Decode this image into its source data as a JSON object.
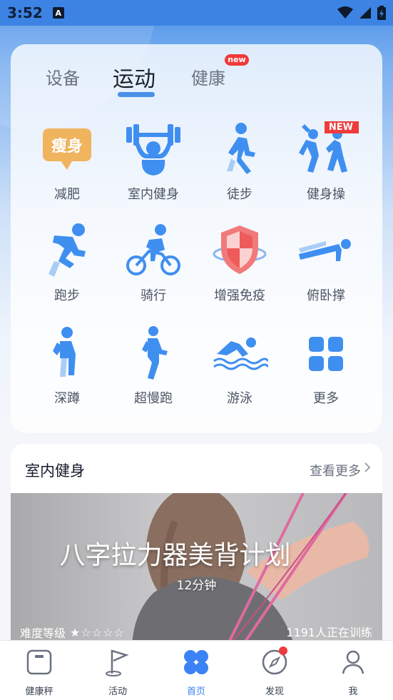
{
  "status": {
    "time": "3:52",
    "a_icon": "A"
  },
  "tabs": [
    {
      "label": "设备",
      "active": false
    },
    {
      "label": "运动",
      "active": true
    },
    {
      "label": "健康",
      "active": false,
      "badge": "new"
    }
  ],
  "grid": [
    {
      "label": "减肥",
      "icon": "weight-loss-icon",
      "icon_text": "瘦身"
    },
    {
      "label": "室内健身",
      "icon": "dumbbell-icon"
    },
    {
      "label": "徒步",
      "icon": "walking-icon"
    },
    {
      "label": "健身操",
      "icon": "aerobics-icon",
      "badge": "NEW"
    },
    {
      "label": "跑步",
      "icon": "running-icon"
    },
    {
      "label": "骑行",
      "icon": "cycling-icon"
    },
    {
      "label": "增强免疫",
      "icon": "shield-icon"
    },
    {
      "label": "俯卧撑",
      "icon": "pushup-icon"
    },
    {
      "label": "深蹲",
      "icon": "squat-icon"
    },
    {
      "label": "超慢跑",
      "icon": "slow-jog-icon"
    },
    {
      "label": "游泳",
      "icon": "swimming-icon"
    },
    {
      "label": "更多",
      "icon": "more-grid-icon"
    }
  ],
  "section": {
    "title": "室内健身",
    "more": "查看更多",
    "banner": {
      "title": "八字拉力器美背计划",
      "duration": "12分钟",
      "difficulty_label": "难度等级",
      "difficulty_stars": 1,
      "difficulty_max": 5,
      "stars_text": "★☆☆☆☆",
      "participants": "1191人正在训练"
    }
  },
  "nav": [
    {
      "label": "健康秤",
      "icon": "scale-icon",
      "active": false
    },
    {
      "label": "活动",
      "icon": "flag-icon",
      "active": false
    },
    {
      "label": "首页",
      "icon": "home-clover-icon",
      "active": true
    },
    {
      "label": "发现",
      "icon": "compass-icon",
      "active": false,
      "dot": true
    },
    {
      "label": "我",
      "icon": "person-icon",
      "active": false
    }
  ],
  "colors": {
    "accent": "#4a90e8",
    "badge": "#ef3b3b",
    "icon_blue": "#3f8ff0"
  }
}
